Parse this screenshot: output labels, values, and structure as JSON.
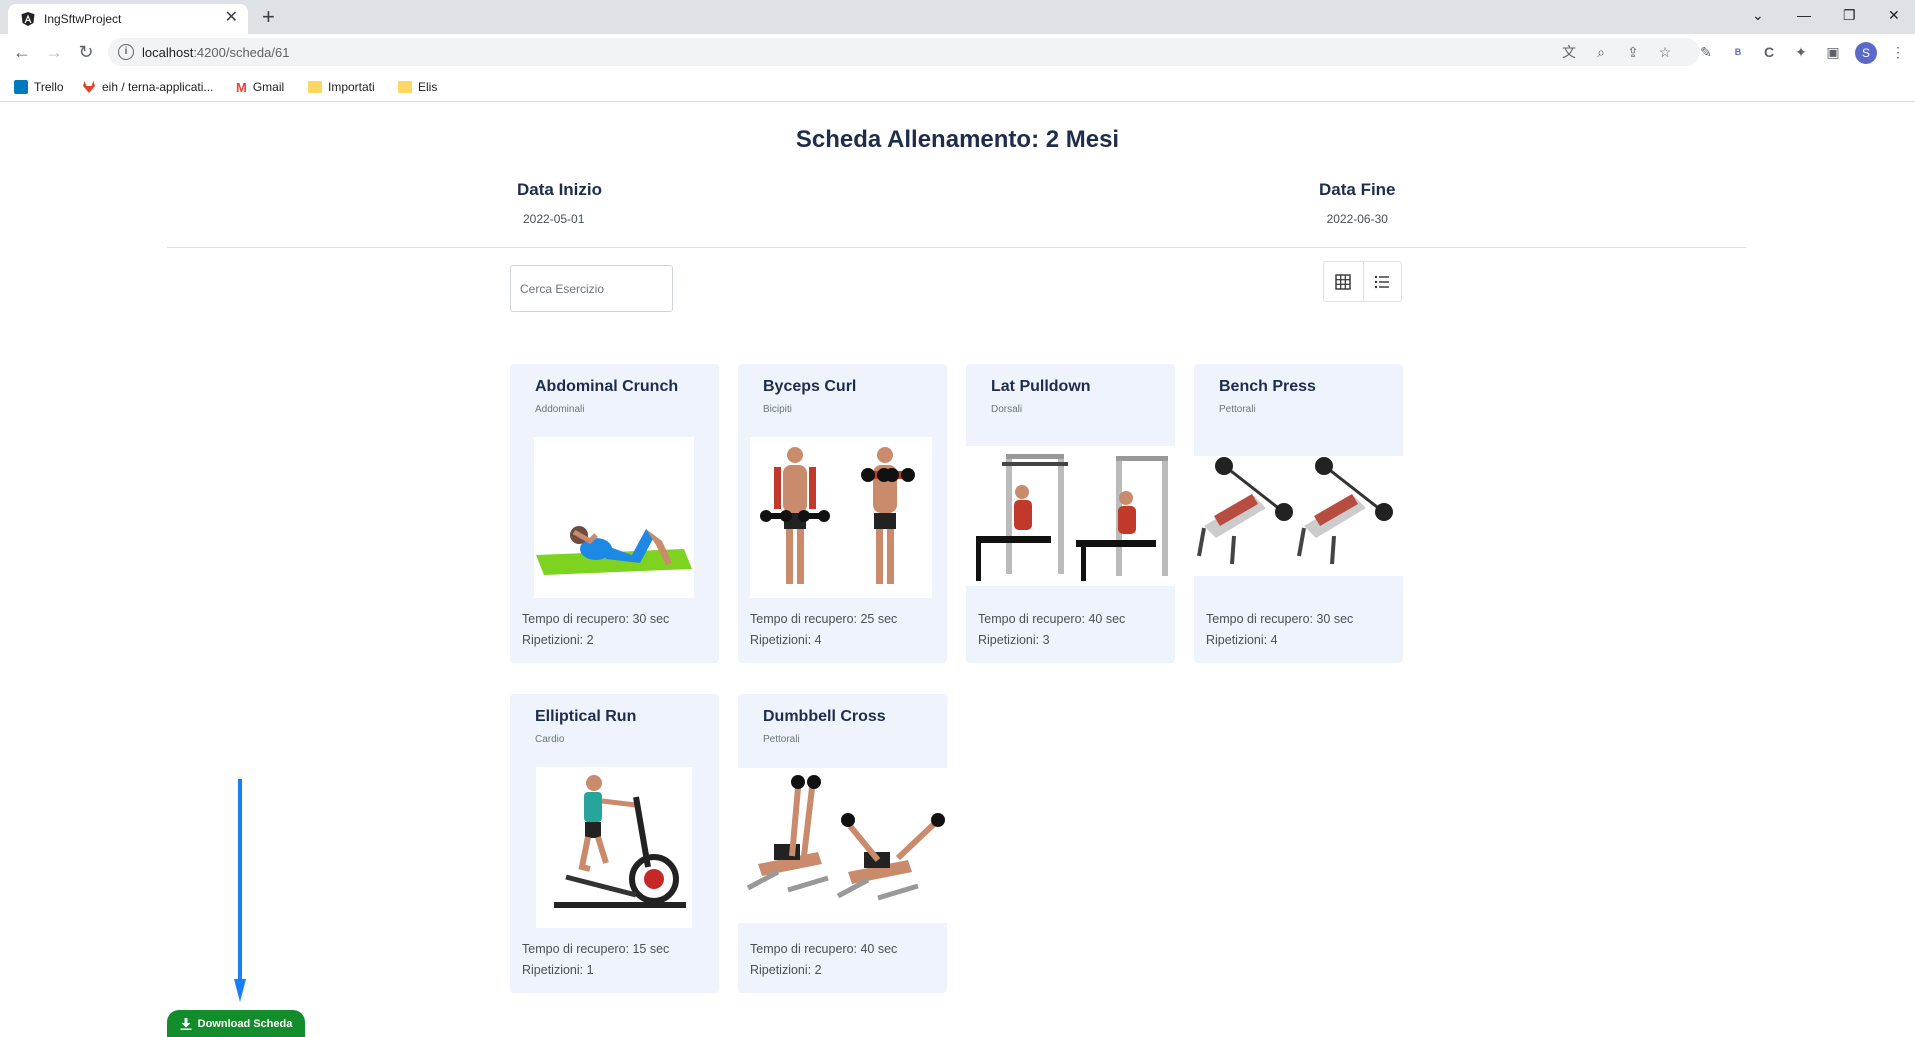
{
  "browser": {
    "tab_title": "IngSftwProject",
    "url_host": "localhost",
    "url_path": ":4200/scheda/61",
    "bookmarks": [
      {
        "label": "Trello",
        "icon": "trello-icon",
        "color": "#0079bf"
      },
      {
        "label": "eih / terna-applicati...",
        "icon": "gitlab-icon",
        "color": "#e24329"
      },
      {
        "label": "Gmail",
        "icon": "gmail-icon",
        "color": "#ea4335"
      },
      {
        "label": "Importati",
        "icon": "folder-icon",
        "color": "#fdd663"
      },
      {
        "label": "Elis",
        "icon": "folder-icon",
        "color": "#fdd663"
      }
    ],
    "profile_initial": "S"
  },
  "page": {
    "title": "Scheda Allenamento: 2 Mesi",
    "start_label": "Data Inizio",
    "start_value": "2022-05-01",
    "end_label": "Data Fine",
    "end_value": "2022-06-30",
    "search_placeholder": "Cerca Esercizio",
    "view_modes": [
      "grid-icon",
      "list-icon"
    ],
    "download_label": "Download Scheda"
  },
  "exercises": [
    {
      "name": "Abdominal Crunch",
      "muscle": "Addominali",
      "rest": "Tempo di recupero: 30 sec",
      "reps": "Ripetizioni: 2"
    },
    {
      "name": "Byceps Curl",
      "muscle": "Bicipiti",
      "rest": "Tempo di recupero: 25 sec",
      "reps": "Ripetizioni: 4"
    },
    {
      "name": "Lat Pulldown",
      "muscle": "Dorsali",
      "rest": "Tempo di recupero: 40 sec",
      "reps": "Ripetizioni: 3"
    },
    {
      "name": "Bench Press",
      "muscle": "Pettorali",
      "rest": "Tempo di recupero: 30 sec",
      "reps": "Ripetizioni: 4"
    },
    {
      "name": "Elliptical Run",
      "muscle": "Cardio",
      "rest": "Tempo di recupero: 15 sec",
      "reps": "Ripetizioni: 1"
    },
    {
      "name": "Dumbbell Cross",
      "muscle": "Pettorali",
      "rest": "Tempo di recupero: 40 sec",
      "reps": "Ripetizioni: 2"
    }
  ],
  "colors": {
    "card_bg": "#eef3fc",
    "title_color": "#1f2d4d",
    "download_green": "#138d2c",
    "arrow_blue": "#1a7ef5"
  }
}
